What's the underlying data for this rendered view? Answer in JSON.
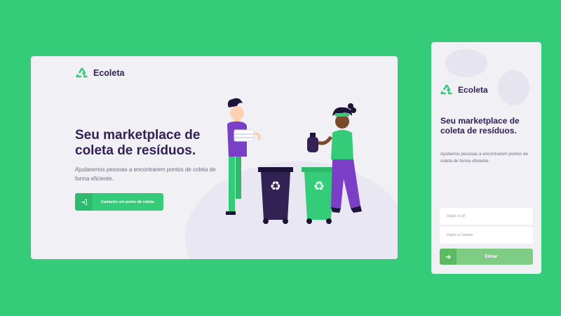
{
  "desktop": {
    "brand": {
      "name": "Ecoleta",
      "icon": "recycle-icon"
    },
    "hero": {
      "title": "Seu marketplace de coleta de resíduos.",
      "subtitle": "Ajudaremos pessoas a encontrarem pontos de coleta de forma eficiente."
    },
    "cta": {
      "label": "Cadastre um ponto de coleta.",
      "icon": "login-icon"
    }
  },
  "mobile": {
    "brand": {
      "name": "Ecoleta",
      "icon": "recycle-icon"
    },
    "title": "Seu marketplace de coleta de resíduos.",
    "subtitle": "Ajudamos pessoas a encontrarem pontos de coleta de forma eficiente.",
    "uf_placeholder": "Digite a UF",
    "city_placeholder": "Digite a Cidade",
    "enter": {
      "label": "Entrar",
      "icon": "arrow-right-icon"
    }
  },
  "colors": {
    "background": "#34cb79",
    "primary": "#34cb79",
    "title": "#322153",
    "text": "#6c6c80",
    "card": "#f0f0f5",
    "button_disabled": "#7fcd85"
  }
}
